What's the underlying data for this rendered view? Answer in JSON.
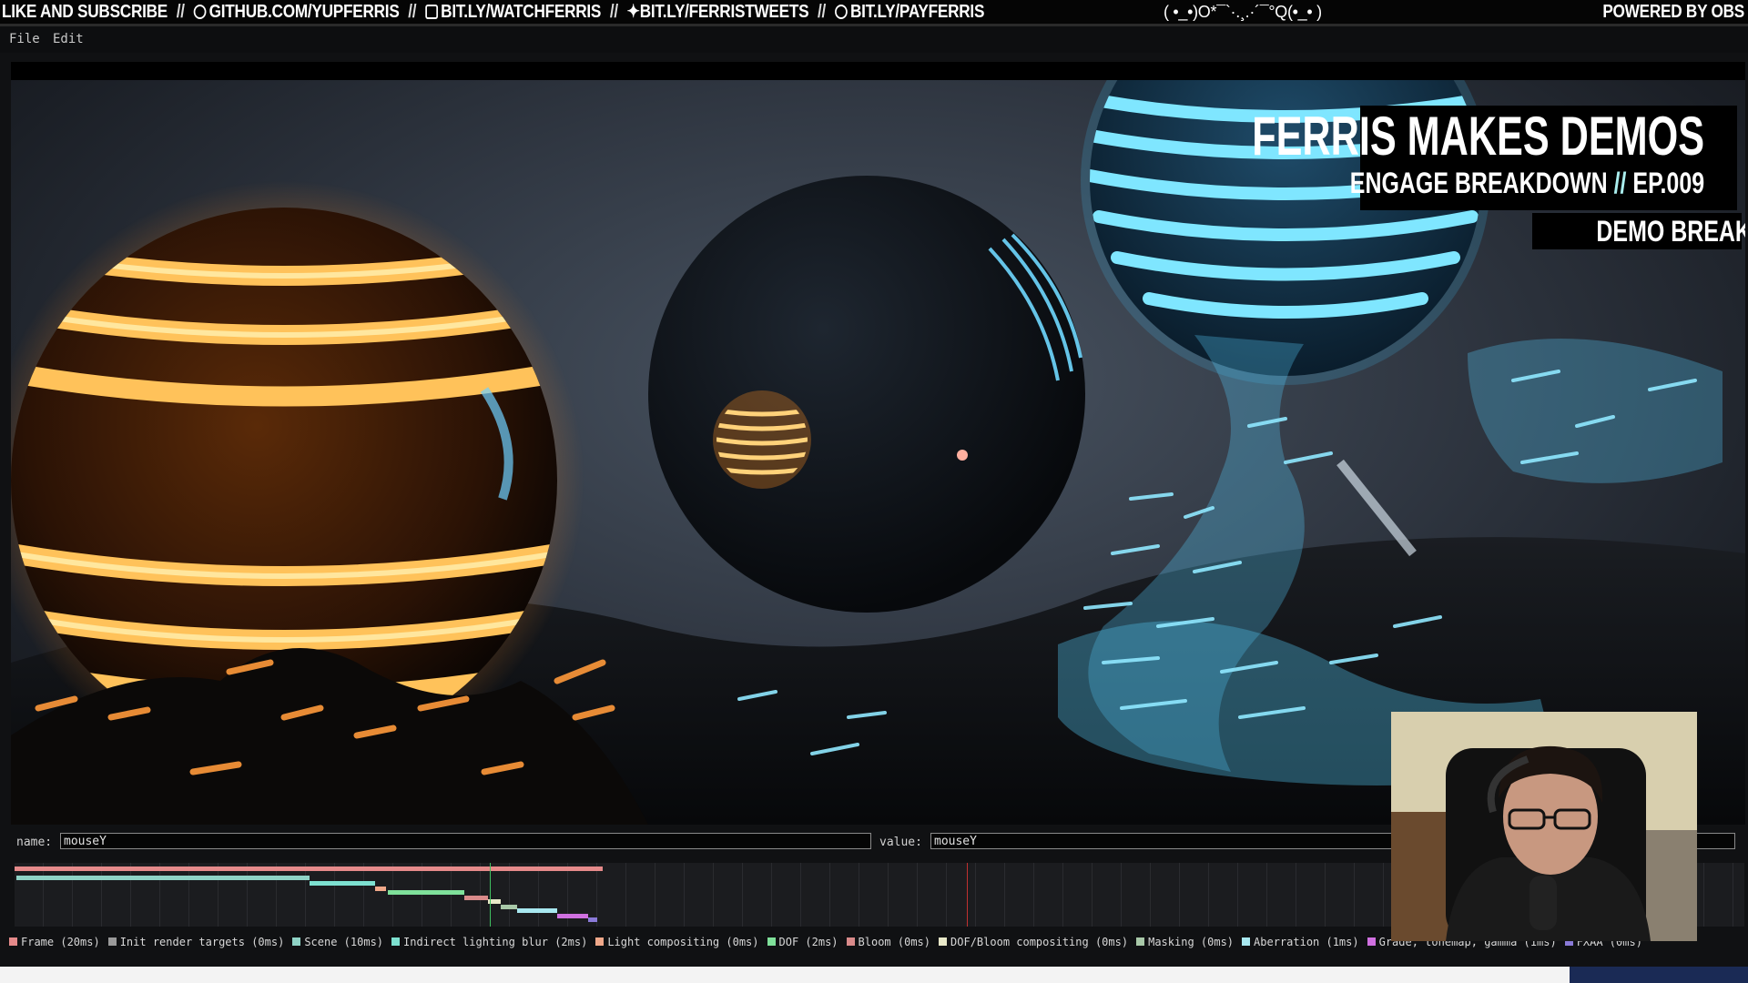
{
  "banner": {
    "left_parts": [
      {
        "text": "LIKE AND SUBSCRIBE",
        "icon": null
      },
      {
        "text": "GITHUB.COM/YUPFERRIS",
        "icon": "github-icon"
      },
      {
        "text": "BIT.LY/WATCHFERRIS",
        "icon": "twitch-icon"
      },
      {
        "text": "BIT.LY/FERRISTWEETS",
        "icon": "twitter-icon"
      },
      {
        "text": "BIT.LY/PAYFERRIS",
        "icon": "patreon-icon"
      }
    ],
    "separator": "//",
    "center": "( •_•)O*¯`·.¸.·´¯°Q(•_• )",
    "right": "POWERED BY OBS"
  },
  "menu": {
    "file": "File",
    "edit": "Edit"
  },
  "overlay": {
    "title": "FERRIS MAKES DEMOS",
    "subtitle_left": "ENGAGE BREAKDOWN",
    "subtitle_sep": "//",
    "subtitle_right": "EP.009",
    "badge": "DEMO BREAKDOWN"
  },
  "fields": {
    "name_label": "name:",
    "name_value": "mouseY",
    "value_label": "value:",
    "value_value": "mouseY"
  },
  "legend": [
    {
      "label": "Frame (20ms)",
      "color": "#e58a8a"
    },
    {
      "label": "Init render targets (0ms)",
      "color": "#9a9a9a"
    },
    {
      "label": "Scene (10ms)",
      "color": "#8fd3c6"
    },
    {
      "label": "Indirect lighting blur (2ms)",
      "color": "#7de0d0"
    },
    {
      "label": "Light compositing (0ms)",
      "color": "#f0a88a"
    },
    {
      "label": "DOF (2ms)",
      "color": "#7fe09a"
    },
    {
      "label": "Bloom (0ms)",
      "color": "#d98a8a"
    },
    {
      "label": "DOF/Bloom compositing (0ms)",
      "color": "#e8e8c8"
    },
    {
      "label": "Masking (0ms)",
      "color": "#a8c8a8"
    },
    {
      "label": "Aberration (1ms)",
      "color": "#a8e8f0"
    },
    {
      "label": "Grade, tonemap, gamma (1ms)",
      "color": "#d070e0"
    },
    {
      "label": "FXAA (0ms)",
      "color": "#8a7ad8"
    }
  ],
  "colors": {
    "accent_orange": "#ffb040",
    "accent_blue": "#40c8ff",
    "timeline_current": "#40c060",
    "timeline_marker": "#c03030"
  }
}
